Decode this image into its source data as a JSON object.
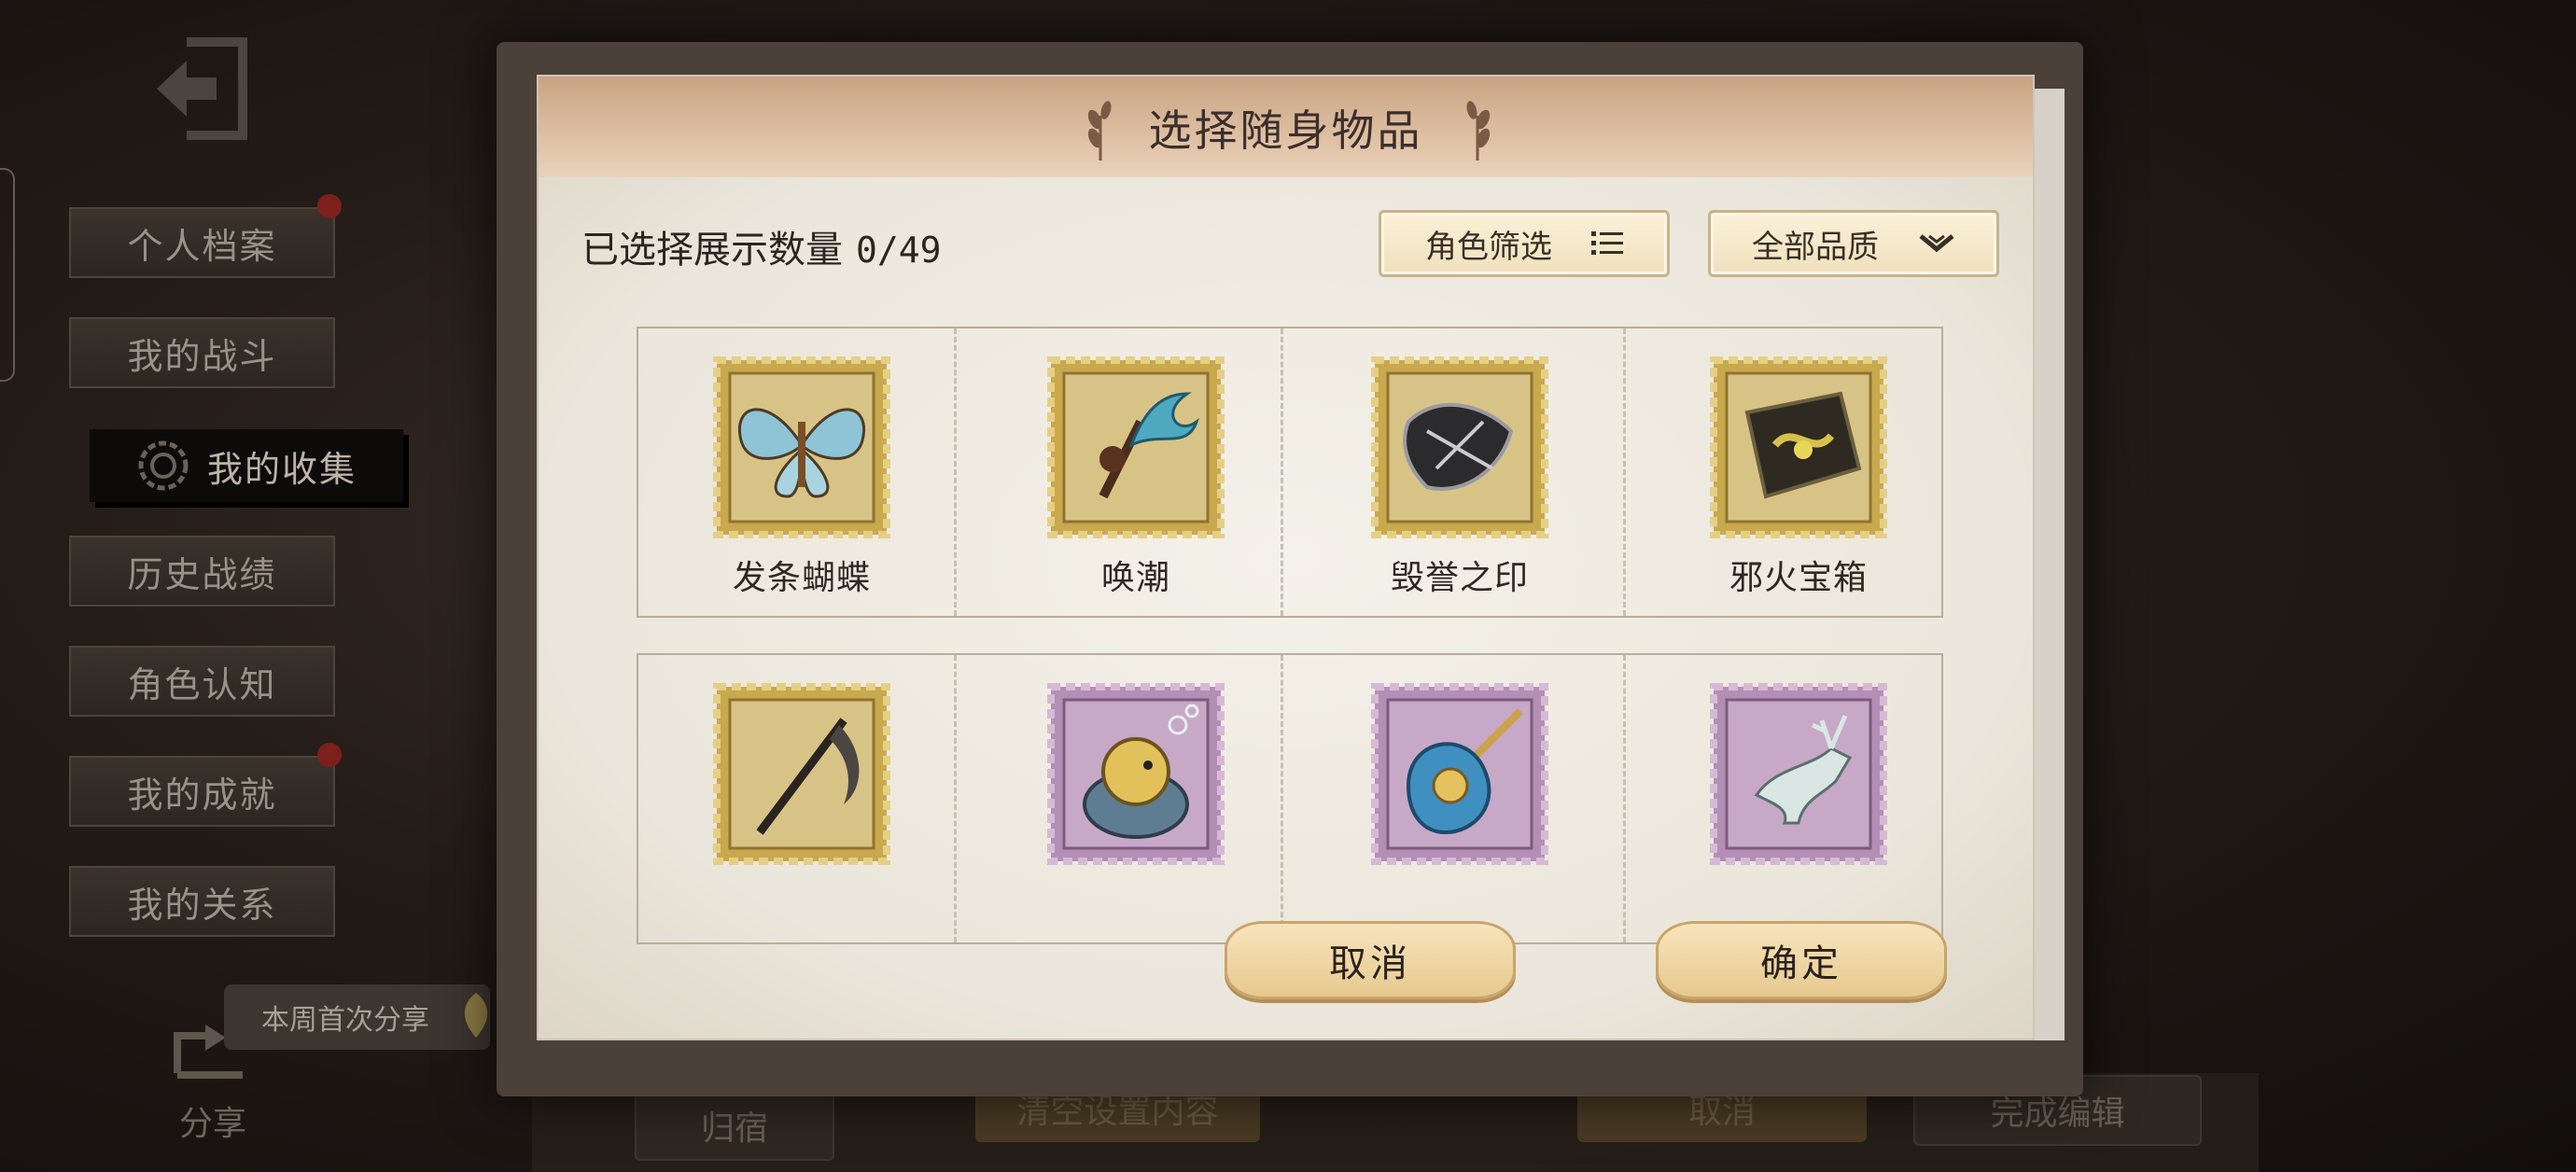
{
  "background": {
    "sidebar": [
      {
        "label": "个人档案",
        "badge": true
      },
      {
        "label": "我的战斗",
        "badge": false
      },
      {
        "label": "我的收集",
        "badge": false,
        "active": true
      },
      {
        "label": "历史战绩",
        "badge": false
      },
      {
        "label": "角色认知",
        "badge": false
      },
      {
        "label": "我的成就",
        "badge": true
      },
      {
        "label": "我的关系",
        "badge": false
      }
    ],
    "share_label": "分享",
    "share_tip": "本周首次分享",
    "bottom": {
      "dorm": "归宿",
      "clear": "清空设置内容",
      "cancel": "取消",
      "finish": "完成编辑"
    }
  },
  "dialog": {
    "title": "选择随身物品",
    "count_label": "已选择展示数量",
    "count_value": "0/49",
    "filter_role": "角色筛选",
    "filter_quality": "全部品质",
    "items": [
      {
        "name": "发条蝴蝶",
        "icon": "clockwork-butterfly-icon",
        "frame": "gold"
      },
      {
        "name": "唤潮",
        "icon": "tide-caller-icon",
        "frame": "gold"
      },
      {
        "name": "毁誉之印",
        "icon": "seal-of-infamy-icon",
        "frame": "gold"
      },
      {
        "name": "邪火宝箱",
        "icon": "evil-fire-chest-icon",
        "frame": "gold"
      },
      {
        "name": "",
        "icon": "scythe-icon",
        "frame": "gold"
      },
      {
        "name": "",
        "icon": "pufferfish-jar-icon",
        "frame": "purple"
      },
      {
        "name": "",
        "icon": "shell-mace-icon",
        "frame": "purple"
      },
      {
        "name": "",
        "icon": "deer-icon",
        "frame": "purple"
      }
    ],
    "cancel": "取消",
    "confirm": "确定"
  },
  "colors": {
    "gold_stamp": "#c9a94d",
    "purple_stamp": "#b48fb5",
    "button_gold": "#e6c98e"
  }
}
